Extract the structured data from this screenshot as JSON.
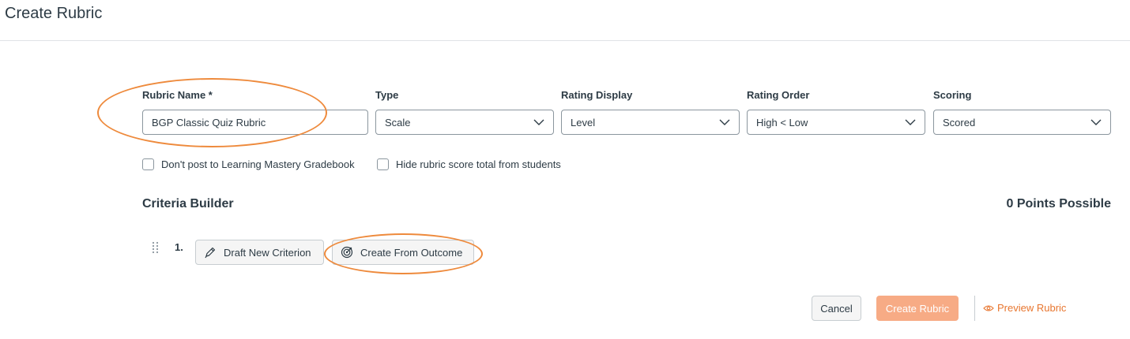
{
  "page": {
    "title": "Create Rubric"
  },
  "fields": {
    "rubric_name": {
      "label": "Rubric Name *",
      "value": "BGP Classic Quiz Rubric"
    },
    "type": {
      "label": "Type",
      "value": "Scale"
    },
    "rating_display": {
      "label": "Rating Display",
      "value": "Level"
    },
    "rating_order": {
      "label": "Rating Order",
      "value": "High < Low"
    },
    "scoring": {
      "label": "Scoring",
      "value": "Scored"
    }
  },
  "checkboxes": {
    "dont_post": {
      "label": "Don't post to Learning Mastery Gradebook",
      "checked": false
    },
    "hide_total": {
      "label": "Hide rubric score total from students",
      "checked": false
    }
  },
  "criteria": {
    "heading": "Criteria Builder",
    "points": "0 Points Possible",
    "row_number": "1.",
    "draft_button": "Draft New Criterion",
    "outcome_button": "Create From Outcome"
  },
  "footer": {
    "cancel": "Cancel",
    "create": "Create Rubric",
    "preview": "Preview Rubric"
  },
  "icons": {
    "chevron": "chevron-down-icon",
    "drag": "drag-handle-icon",
    "pencil": "pencil-icon",
    "outcome": "outcome-target-icon",
    "eye": "eye-icon"
  },
  "colors": {
    "text": "#2d3b45",
    "annotation": "#ee8a3c",
    "create_button_bg": "#f7ab85",
    "preview_link": "#e8762f"
  }
}
